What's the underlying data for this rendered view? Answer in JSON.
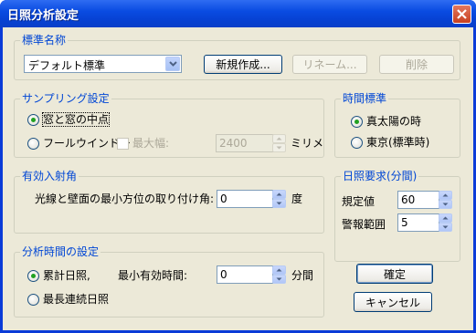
{
  "window": {
    "title": "日照分析設定"
  },
  "std_name": {
    "group_title": "標準名称",
    "combo_value": "デフォルト標準",
    "new_button": "新規作成...",
    "rename_button": "リネーム...",
    "delete_button": "削除"
  },
  "sampling": {
    "group_title": "サンプリング設定",
    "option1": "窓と窓の中点",
    "option2": "フールウインドー",
    "max_width_label": "最大幅:",
    "max_width_value": "2400",
    "unit": "ミリメ"
  },
  "time_std": {
    "group_title": "時間標準",
    "option1": "真太陽の時",
    "option2": "東京(標準時)"
  },
  "angle": {
    "group_title": "有効入射角",
    "label": "光線と壁面の最小方位の取り付け角:",
    "value": "0",
    "unit": "度"
  },
  "requirement": {
    "group_title": "日照要求(分間)",
    "spec_label": "規定値",
    "spec_value": "60",
    "warn_label": "警報範囲",
    "warn_value": "5"
  },
  "analysis_time": {
    "group_title": "分析時間の設定",
    "option1": "累計日照,",
    "min_label": "最小有効時間:",
    "min_value": "0",
    "min_unit": "分間",
    "option2": "最長連続日照"
  },
  "buttons": {
    "ok": "確定",
    "cancel": "キャンセル"
  }
}
